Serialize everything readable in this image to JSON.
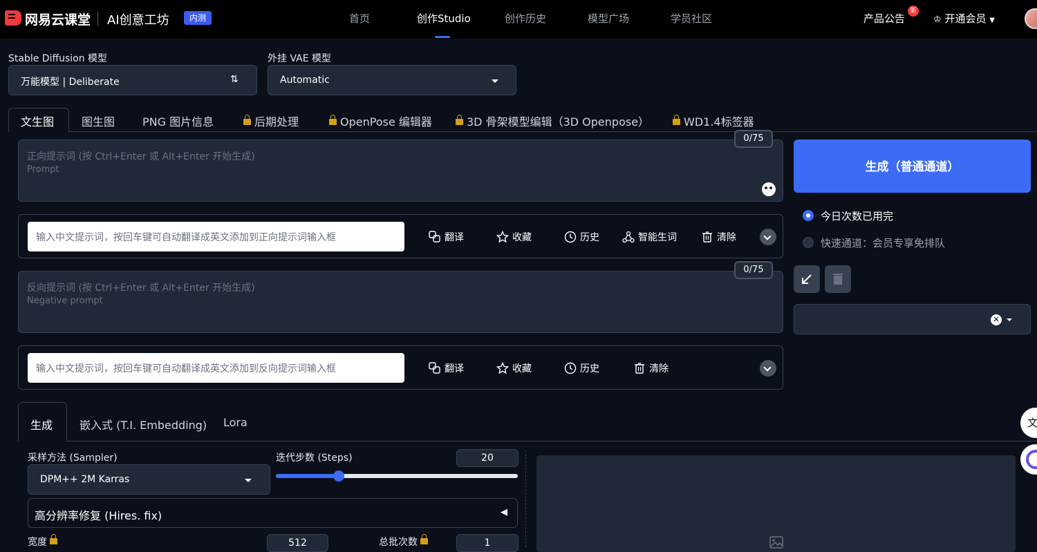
{
  "nav": {
    "brand": "网易云课堂",
    "product": "AI创意工坊",
    "beta": "内测",
    "links": [
      "首页",
      "创作Studio",
      "创作历史",
      "模型广场",
      "学员社区"
    ],
    "announce": "产品公告",
    "new_badge": "新",
    "vip": "开通会员"
  },
  "model": {
    "sd_label": "Stable Diffusion 模型",
    "sd_value": "万能模型 | Deliberate",
    "vae_label": "外挂 VAE 模型",
    "vae_value": "Automatic"
  },
  "tabs": [
    "文生图",
    "图生图",
    "PNG 图片信息",
    "后期处理",
    "OpenPose 编辑器",
    "3D 骨架模型编辑（3D Openpose）",
    "WD1.4标签器"
  ],
  "prompt": {
    "placeholder_main": "正向提示词 (按 Ctrl+Enter 或 Alt+Enter 开始生成)",
    "placeholder_sub": "Prompt",
    "counter": "0/75",
    "translate_placeholder": "输入中文提示词，按回车键可自动翻译成英文添加到正向提示词输入框"
  },
  "negative": {
    "placeholder_main": "反向提示词 (按 Ctrl+Enter 或 Alt+Enter 开始生成)",
    "placeholder_sub": "Negative prompt",
    "counter": "0/75",
    "translate_placeholder": "输入中文提示词，按回车键可自动翻译成英文添加到反向提示词输入框"
  },
  "tools": {
    "translate": "翻译",
    "favorite": "收藏",
    "history": "历史",
    "smart": "智能生词",
    "clear": "清除"
  },
  "generate": {
    "button": "生成（普通通道）",
    "option1": "今日次数已用完",
    "option2": "快速通道：会员专享免排队"
  },
  "subtabs": [
    "生成",
    "嵌入式 (T.I. Embedding)",
    "Lora"
  ],
  "params": {
    "sampler_label": "采样方法 (Sampler)",
    "sampler_value": "DPM++ 2M Karras",
    "steps_label": "迭代步数 (Steps)",
    "steps_value": "20",
    "steps_fraction": 0.26,
    "hires_label": "高分辨率修复 (Hires. fix)",
    "width_label": "宽度",
    "width_value": "512",
    "batch_label": "总批次数",
    "batch_value": "1"
  },
  "colors": {
    "accent": "#3c6cf5",
    "background": "#0b0f19",
    "panel": "#1f2937"
  }
}
